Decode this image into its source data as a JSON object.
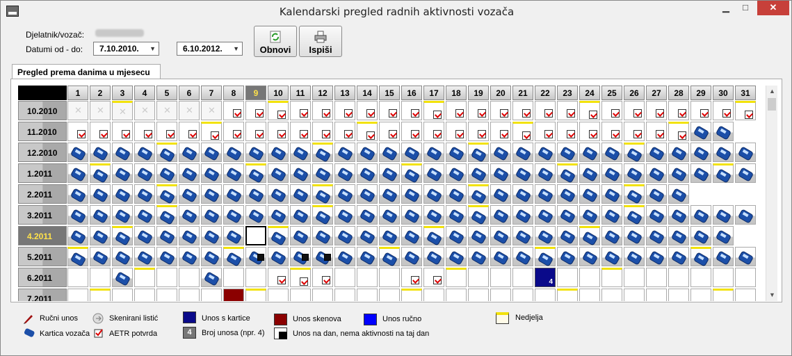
{
  "window": {
    "title": "Kalendarski pregled radnih aktivnosti vozača",
    "min": "▁",
    "max": "□",
    "close": "✕"
  },
  "filters": {
    "driver_label": "Djelatnik/vozač:",
    "dates_label": "Datumi od - do:",
    "date_from": "7.10.2010.",
    "date_to": "6.10.2012."
  },
  "buttons": {
    "refresh": "Obnovi",
    "print": "Ispiši"
  },
  "tab": "Pregled prema danima u mjesecu",
  "days": [
    "1",
    "2",
    "3",
    "4",
    "5",
    "6",
    "7",
    "8",
    "9",
    "10",
    "11",
    "12",
    "13",
    "14",
    "15",
    "16",
    "17",
    "18",
    "19",
    "20",
    "21",
    "22",
    "23",
    "24",
    "25",
    "26",
    "27",
    "28",
    "29",
    "30",
    "31"
  ],
  "current_day_index": 8,
  "months": [
    {
      "label": "10.2010",
      "cells": "eeeeeeeaaaaaaaaaaaaaaaaaaaaaaaa",
      "sun": [
        2,
        9,
        16,
        23,
        30
      ]
    },
    {
      "label": "11.2010",
      "cells": "aaaaaaaaaaaaaaaaaaaaaaaaaaaaccx",
      "sun": [
        6,
        13,
        20,
        27
      ]
    },
    {
      "label": "12.2010",
      "cells": "ccccccccccccccccccccccccccccccc",
      "sun": [
        4,
        11,
        18,
        25
      ]
    },
    {
      "label": "1.2011",
      "cells": "ccccccccccccccccccccccccccccccc",
      "sun": [
        1,
        8,
        15,
        22,
        29
      ]
    },
    {
      "label": "2.2011",
      "cells": "ccccccccccccccccccccccccccccxxx",
      "sun": [
        4,
        11,
        18,
        25
      ]
    },
    {
      "label": "3.2011",
      "cells": "ccccccccccccccccccccccccccccccc",
      "sun": [
        4,
        11,
        18,
        25
      ]
    },
    {
      "label": "4.2011",
      "cells": "cccccccc.cccccccccccccccccccccx",
      "sun": [
        2,
        9,
        16,
        23
      ]
    },
    {
      "label": "5.2011",
      "cells": "ccccccccdcddcccccccccccccccccccc",
      "sun": [
        0,
        7,
        14,
        21,
        28
      ]
    },
    {
      "label": "6.2011",
      "cells": "..c...c..aaa...aa....4..........x",
      "sun": [
        3,
        10,
        17,
        24
      ]
    },
    {
      "label": "7.2011",
      "cells": ".......r........................",
      "sun": [
        1,
        8,
        15,
        22,
        29
      ]
    }
  ],
  "selected_cell": {
    "row": 6,
    "col": 8
  },
  "counter_cell": {
    "row": 8,
    "col": 21,
    "count": "4"
  },
  "legend": {
    "manual": "Ručni unos",
    "scanned": "Skenirani listić",
    "card_entry": "Unos s kartice",
    "scan_entry": "Unos skenova",
    "manual_entry": "Unos ručno",
    "sunday": "Nedjelja",
    "driver_card": "Kartica vozača",
    "aetr": "AETR potvrda",
    "count_note": "Broj unosa (npr. 4)",
    "no_activity": "Unos na dan, nema aktivnosti na taj dan",
    "count_example": "4"
  },
  "colors": {
    "card_entry": "#0a0a8a",
    "scan_entry": "#8b0000",
    "manual_entry": "#0000ff",
    "sunday": "#f2e20a"
  }
}
